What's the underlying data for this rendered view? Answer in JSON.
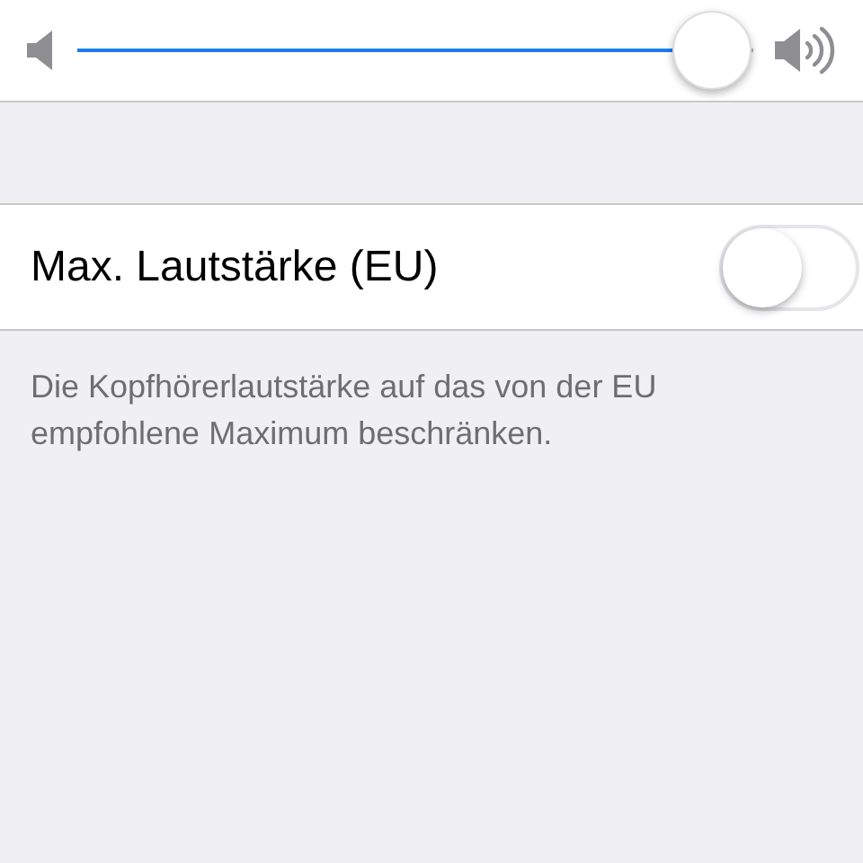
{
  "volume_slider": {
    "level": 0.94
  },
  "settings_row": {
    "label": "Max. Lautstärke (EU)",
    "on": false
  },
  "footer_note": "Die Kopfhörerlautstärke auf das von der EU empfohlene Maximum beschränken."
}
